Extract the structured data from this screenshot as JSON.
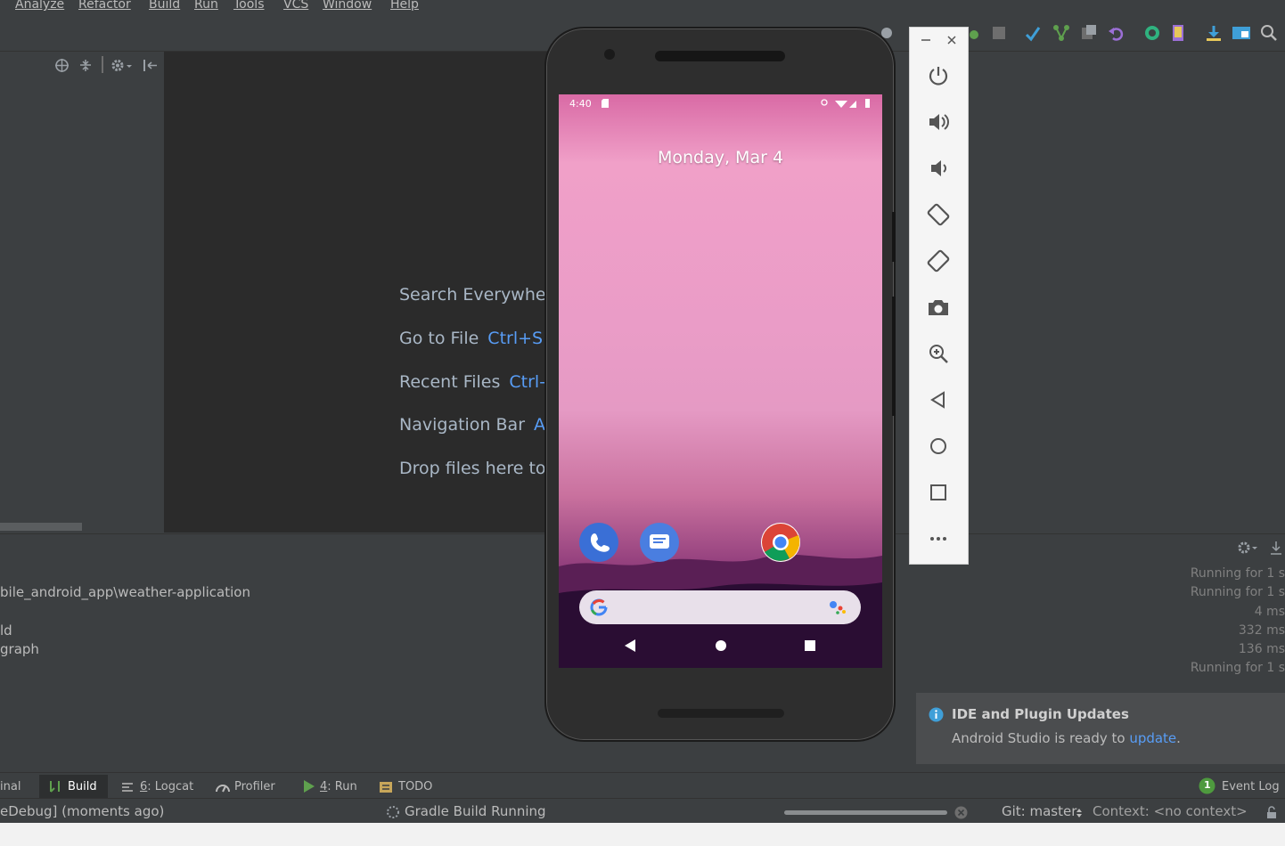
{
  "menu": [
    "Analyze",
    "Refactor",
    "Build",
    "Run",
    "Tools",
    "VCS",
    "Window",
    "Help"
  ],
  "editor_hints": [
    {
      "label": "Search Everywhe",
      "key": ""
    },
    {
      "label": "Go to File",
      "key": "Ctrl+S"
    },
    {
      "label": "Recent Files",
      "key": "Ctrl-"
    },
    {
      "label": "Navigation Bar",
      "key": "A"
    },
    {
      "label": "Drop files here to",
      "key": ""
    }
  ],
  "build_output": {
    "lines": [
      "bile_android_app\\weather-application",
      "ld",
      "graph"
    ],
    "timings": [
      "Running for 1 s",
      "Running for 1 s",
      "4 ms",
      "332 ms",
      "136 ms",
      "Running for 1 s"
    ]
  },
  "notification": {
    "title": "IDE and Plugin Updates",
    "message_prefix": "Android Studio is ready to ",
    "link": "update",
    "message_suffix": "."
  },
  "tool_windows": {
    "terminal": "inal",
    "build": "Build",
    "logcat_num": "6",
    "logcat": ": Logcat",
    "profiler": "Profiler",
    "run_num": "4",
    "run": ": Run",
    "todo": "TODO",
    "event_log": "Event Log",
    "event_log_count": "1"
  },
  "status_bar": {
    "left": "eDebug] (moments ago)",
    "progress": "Gradle Build Running",
    "git": "Git: master",
    "context": "Context: <no context>"
  },
  "phone": {
    "time": "4:40",
    "date": "Monday, Mar 4"
  },
  "colors": {
    "accent": "#589df6",
    "editor_bg": "#2b2b2b",
    "panel_bg": "#3c3f41"
  }
}
